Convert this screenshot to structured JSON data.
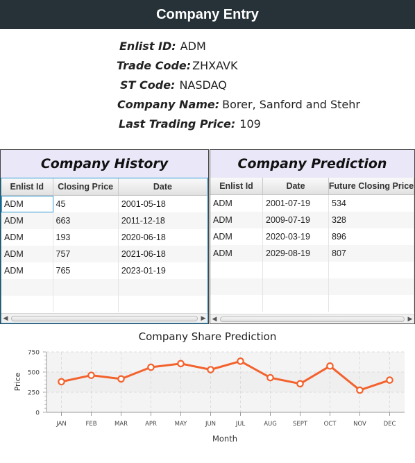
{
  "window": {
    "title": "Company Entry"
  },
  "info": {
    "enlist_id_label": "Enlist ID:",
    "enlist_id": "ADM",
    "trade_code_label": "Trade Code:",
    "trade_code": "ZHXAVK",
    "st_code_label": "ST Code:",
    "st_code": "NASDAQ",
    "company_name_label": "Company Name:",
    "company_name": "Borer, Sanford and Stehr",
    "last_price_label": "Last Trading Price:",
    "last_price": "109"
  },
  "history": {
    "title": "Company History",
    "columns": [
      "Enlist Id",
      "Closing Price",
      "Date"
    ],
    "rows": [
      [
        "ADM",
        "45",
        "2001-05-18"
      ],
      [
        "ADM",
        "663",
        "2011-12-18"
      ],
      [
        "ADM",
        "193",
        "2020-06-18"
      ],
      [
        "ADM",
        "757",
        "2021-06-18"
      ],
      [
        "ADM",
        "765",
        "2023-01-19"
      ]
    ]
  },
  "prediction": {
    "title": "Company Prediction",
    "columns": [
      "Enlist Id",
      "Date",
      "Future Closing Price"
    ],
    "rows": [
      [
        "ADM",
        "2001-07-19",
        "534"
      ],
      [
        "ADM",
        "2009-07-19",
        "328"
      ],
      [
        "ADM",
        "2020-03-19",
        "896"
      ],
      [
        "ADM",
        "2029-08-19",
        "807"
      ]
    ]
  },
  "chart_data": {
    "type": "line",
    "title": "Company Share Prediction",
    "xlabel": "Month",
    "ylabel": "Price",
    "categories": [
      "JAN",
      "FEB",
      "MAR",
      "APR",
      "MAY",
      "JUN",
      "JUL",
      "AUG",
      "SEPT",
      "OCT",
      "NOV",
      "DEC"
    ],
    "values": [
      380,
      460,
      415,
      560,
      605,
      530,
      635,
      430,
      355,
      575,
      275,
      400
    ],
    "yticks": [
      0,
      250,
      500,
      750
    ],
    "ylim": [
      0,
      750
    ],
    "grid": true,
    "line_color": "#f3622d"
  }
}
